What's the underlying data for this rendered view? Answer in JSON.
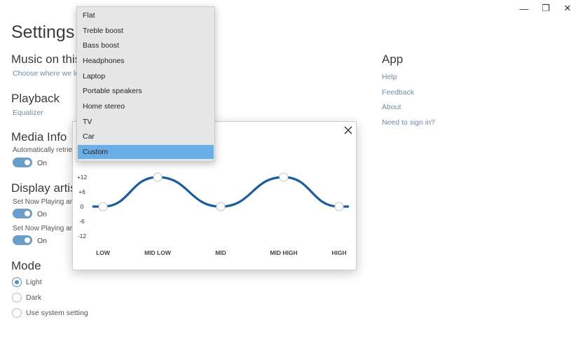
{
  "window": {
    "minimize_glyph": "—",
    "maximize_glyph": "❐",
    "close_glyph": "✕"
  },
  "settings": {
    "title": "Settings",
    "music": {
      "title": "Music on this",
      "link": "Choose where we look"
    },
    "playback": {
      "title": "Playback",
      "link": "Equalizer"
    },
    "media_info": {
      "title": "Media Info",
      "desc": "Automatically retriev",
      "toggle_label": "On"
    },
    "display_artist": {
      "title": "Display artist",
      "row1_desc": "Set Now Playing artis",
      "row1_toggle": "On",
      "row2_desc": "Set Now Playing artis",
      "row2_toggle": "On"
    },
    "mode": {
      "title": "Mode",
      "options": [
        {
          "label": "Light",
          "checked": true
        },
        {
          "label": "Dark",
          "checked": false
        },
        {
          "label": "Use system setting",
          "checked": false
        }
      ]
    },
    "app": {
      "title": "App",
      "links": [
        "Help",
        "Feedback",
        "About",
        "Need to sign in?"
      ]
    }
  },
  "equalizer": {
    "db_labels": [
      "+12",
      "+6",
      "0",
      "-6",
      "-12"
    ],
    "bands": [
      "LOW",
      "MID LOW",
      "MID",
      "MID HIGH",
      "HIGH"
    ],
    "band_levels_db": [
      0,
      12,
      0,
      12,
      0
    ],
    "curve_color": "#1a5c9e"
  },
  "dropdown": {
    "items": [
      "Flat",
      "Treble boost",
      "Bass boost",
      "Headphones",
      "Laptop",
      "Portable speakers",
      "Home stereo",
      "TV",
      "Car",
      "Custom"
    ],
    "selected": "Custom",
    "accent": "#6aaee8"
  }
}
